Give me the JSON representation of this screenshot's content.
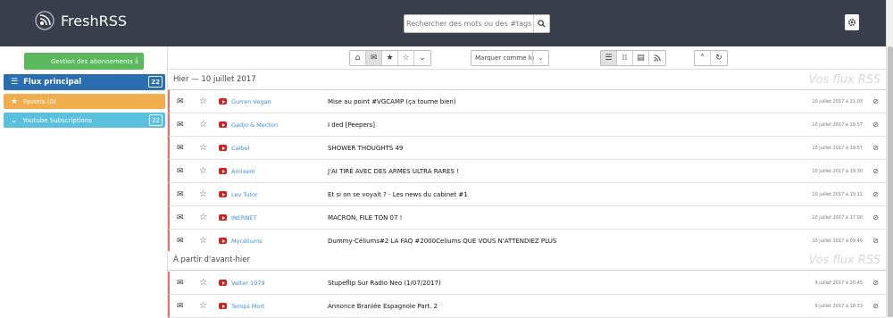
{
  "header": {
    "brand": "FreshRSS",
    "search_placeholder": "Rechercher des mots ou des #tags"
  },
  "sidebar": {
    "manage_label": "Gestion des abonnements",
    "categories": [
      {
        "label": "Flux principal",
        "count": "22",
        "icon": "list-icon"
      },
      {
        "label": "Favoris (0)",
        "icon": "star-icon"
      },
      {
        "label": "Youtube Subscriptions",
        "count": "22",
        "icon": "chevron-down-icon"
      }
    ]
  },
  "toolbar": {
    "mark_as": "Marquer comme lu"
  },
  "groups": [
    {
      "label": "Hier — 10 juillet 2017",
      "feeds_label": "Vos flux RSS",
      "items": [
        {
          "feed": "Gurren Vegan",
          "title": "Mise au point #VGCAMP (ça tourne bien)",
          "date": "10 juillet 2017 à 21:03"
        },
        {
          "feed": "Gadjo & Mecton",
          "title": "I ded [Peepers]",
          "date": "10 juillet 2017 à 19:57"
        },
        {
          "feed": "Calbel",
          "title": "SHOWER THOUGHTS 49",
          "date": "10 juillet 2017 à 19:57"
        },
        {
          "feed": "Amixem",
          "title": "J'AI TIRÉ AVEC DES ARMES ULTRA RARES !",
          "date": "10 juillet 2017 à 19:30"
        },
        {
          "feed": "Lev Tutor",
          "title": "Et si on se voyait ? - Les news du cabinet #1",
          "date": "10 juillet 2017 à 19:11"
        },
        {
          "feed": "INERNET",
          "title": "MACRON, FILE TON 07 !",
          "date": "10 juillet 2017 à 17:00"
        },
        {
          "feed": "Mycéliums",
          "title": "Dummy-Céliums#2 LA FAQ #2000Celiums QUE VOUS N'ATTENDIEZ PLUS",
          "date": "10 juillet 2017 à 09:49"
        }
      ]
    },
    {
      "label": "À partir d'avant-hier",
      "feeds_label": "Vos flux RSS",
      "items": [
        {
          "feed": "Velter 1979",
          "title": "Stupeflip Sur Radio Neo (1/07/2017)",
          "date": "9 juillet 2017 à 20:45"
        },
        {
          "feed": "Temps Mort",
          "title": "Annonce Branlée Espagnole Part. 2",
          "date": "9 juillet 2017 à 18:33"
        }
      ]
    }
  ],
  "colors": {
    "header_bg": "#393f4a",
    "main_category": "#2a6eaf",
    "favorites": "#f0ad4e",
    "youtube_category": "#5bc0de",
    "manage_button": "#5cb85c",
    "unread_border": "#e07373",
    "feed_link": "#3a8fd6"
  }
}
